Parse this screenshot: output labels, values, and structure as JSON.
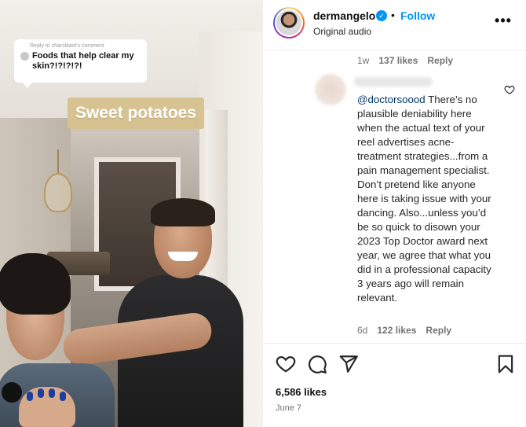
{
  "video": {
    "reply_bubble": {
      "meta": "Reply to charslitast's comment",
      "text": "Foods that help clear my skin?!?!?!?!"
    },
    "caption": "Sweet potatoes"
  },
  "header": {
    "username": "dermangelo",
    "verified_mark": "✓",
    "separator": "•",
    "follow_label": "Follow",
    "audio": "Original audio",
    "more_label": "•••"
  },
  "prev_comment_meta": {
    "time": "1w",
    "likes": "137 likes",
    "reply_label": "Reply"
  },
  "comment": {
    "mention": "@doctorsoood",
    "text": " There’s no plausible deniability here when the actual text of your reel advertises acne-treatment strategies...from a pain management specialist. Don’t pretend like anyone here is taking issue with your dancing. Also...unless you’d be so quick to disown your 2023 Top Doctor award next year, we agree that what you did in a professional capacity 3 years ago will remain relevant.",
    "time": "6d",
    "likes": "122 likes",
    "reply_label": "Reply"
  },
  "post": {
    "likes": "6,586 likes",
    "date": "June 7"
  },
  "icons": {
    "like": "heart-icon",
    "comment": "comment-icon",
    "share": "share-icon",
    "save": "bookmark-icon"
  },
  "colors": {
    "accent": "#0095f6",
    "mention": "#00376b",
    "muted": "#737373"
  }
}
